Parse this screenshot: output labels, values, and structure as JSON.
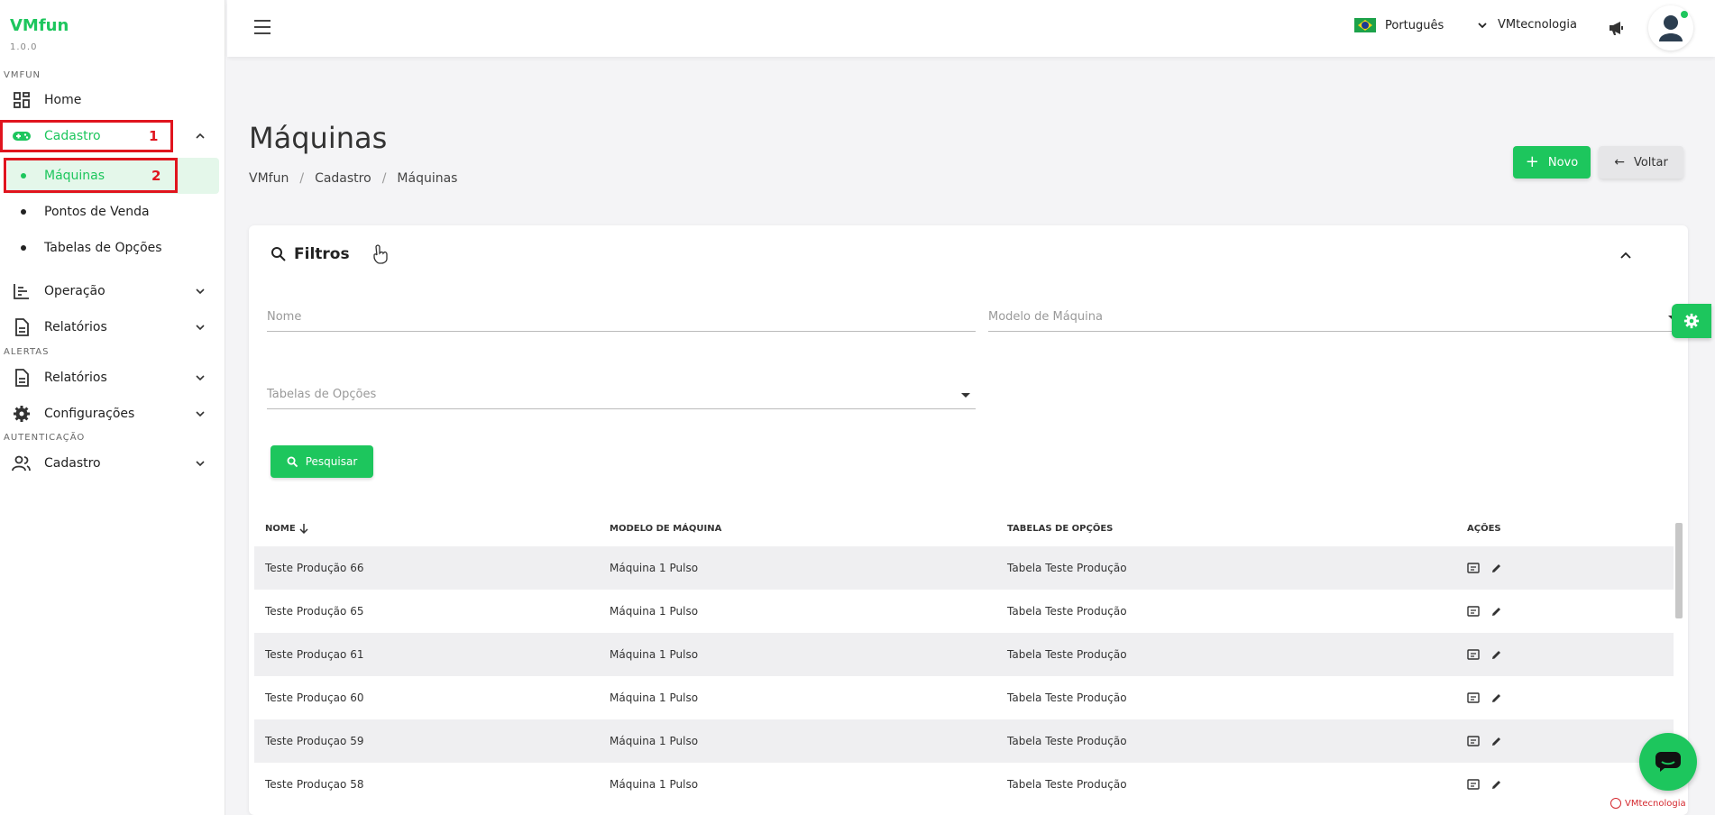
{
  "sidebar": {
    "brand": "VMfun",
    "version": "1.0.0",
    "sections": [
      "VMFUN",
      "ALERTAS",
      "AUTENTICAÇÃO"
    ],
    "home": "Home",
    "cadastro": "Cadastro",
    "sub_items": [
      "Máquinas",
      "Pontos de Venda",
      "Tabelas de Opções"
    ],
    "operacao": "Operação",
    "relatorios": "Relatórios",
    "alert_relatorios": "Relatórios",
    "configuracoes": "Configurações",
    "auth_cadastro": "Cadastro",
    "annotations": [
      "1",
      "2"
    ]
  },
  "topbar": {
    "language": "Português",
    "company": "VMtecnologia"
  },
  "header": {
    "title": "Máquinas",
    "breadcrumb": [
      "VMfun",
      "Cadastro",
      "Máquinas"
    ],
    "new_label": "Novo",
    "back_label": "Voltar"
  },
  "filters": {
    "title": "Filtros",
    "nome_placeholder": "Nome",
    "modelo_placeholder": "Modelo de Máquina",
    "tabelas_placeholder": "Tabelas de Opções",
    "search_label": "Pesquisar"
  },
  "table": {
    "columns": [
      "NOME",
      "MODELO DE MÁQUINA",
      "TABELAS DE OPÇÕES",
      "AÇÕES"
    ],
    "rows": [
      [
        "Teste Produção 66",
        "Máquina 1 Pulso",
        "Tabela Teste Produção"
      ],
      [
        "Teste Produção 65",
        "Máquina 1 Pulso",
        "Tabela Teste Produção"
      ],
      [
        "Teste Produçao 61",
        "Máquina 1 Pulso",
        "Tabela Teste Produção"
      ],
      [
        "Teste Produçao 60",
        "Máquina 1 Pulso",
        "Tabela Teste Produção"
      ],
      [
        "Teste Produçao 59",
        "Máquina 1 Pulso",
        "Tabela Teste Produção"
      ],
      [
        "Teste Produçao 58",
        "Máquina 1 Pulso",
        "Tabela Teste Produção"
      ]
    ]
  },
  "footer": {
    "brand": "VMtecnologia"
  },
  "colors": {
    "accent": "#1dc65d",
    "annotation": "#e0141e"
  }
}
